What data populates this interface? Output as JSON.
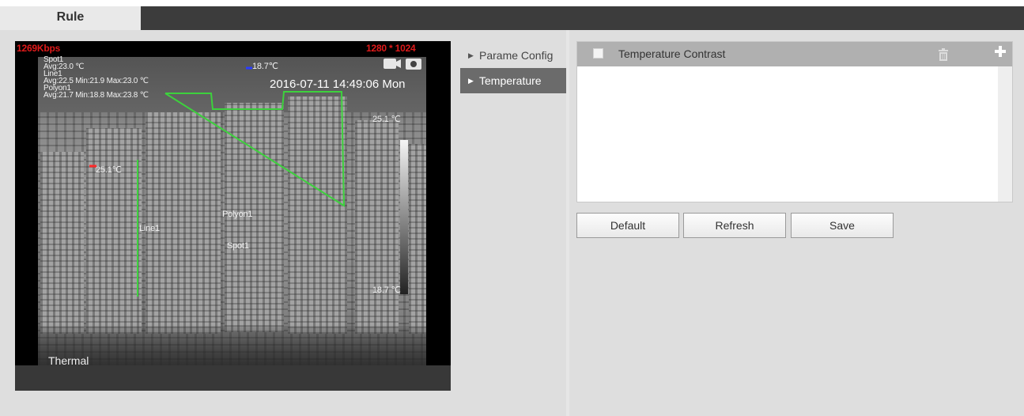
{
  "tabs": {
    "rule_label": "Rule"
  },
  "video": {
    "bitrate": "1269Kbps",
    "resolution": "1280 * 1024",
    "timestamp": "2016-07-11 14:49:06 Mon",
    "channel_label": "Thermal",
    "scale_max": "25.1 ℃",
    "scale_min": "18.7 ℃",
    "marker_blue_value": "18.7℃",
    "marker_red_value": "25.1℃",
    "overlay_lines": [
      "Spot1",
      "Avg:23.0 ℃",
      "Line1",
      "Avg:22.5 Min:21.9 Max:23.0 ℃",
      "Polyon1",
      "Avg:21.7 Min:18.8 Max:23.8 ℃"
    ],
    "labels": {
      "polygon": "Polyon1",
      "line": "Line1",
      "spot": "Spot1"
    },
    "line_color": "#3dd13d"
  },
  "menu": {
    "items": [
      {
        "label": "Parame Config",
        "active": false
      },
      {
        "label": "Temperature",
        "active": true
      }
    ]
  },
  "table": {
    "header_label": "Temperature Contrast"
  },
  "buttons": {
    "default_label": "Default",
    "refresh_label": "Refresh",
    "save_label": "Save"
  },
  "colors": {
    "tab_bar": "#3c3c3c",
    "active_menu": "#6b6b6b",
    "table_header": "#b0b0b0"
  }
}
